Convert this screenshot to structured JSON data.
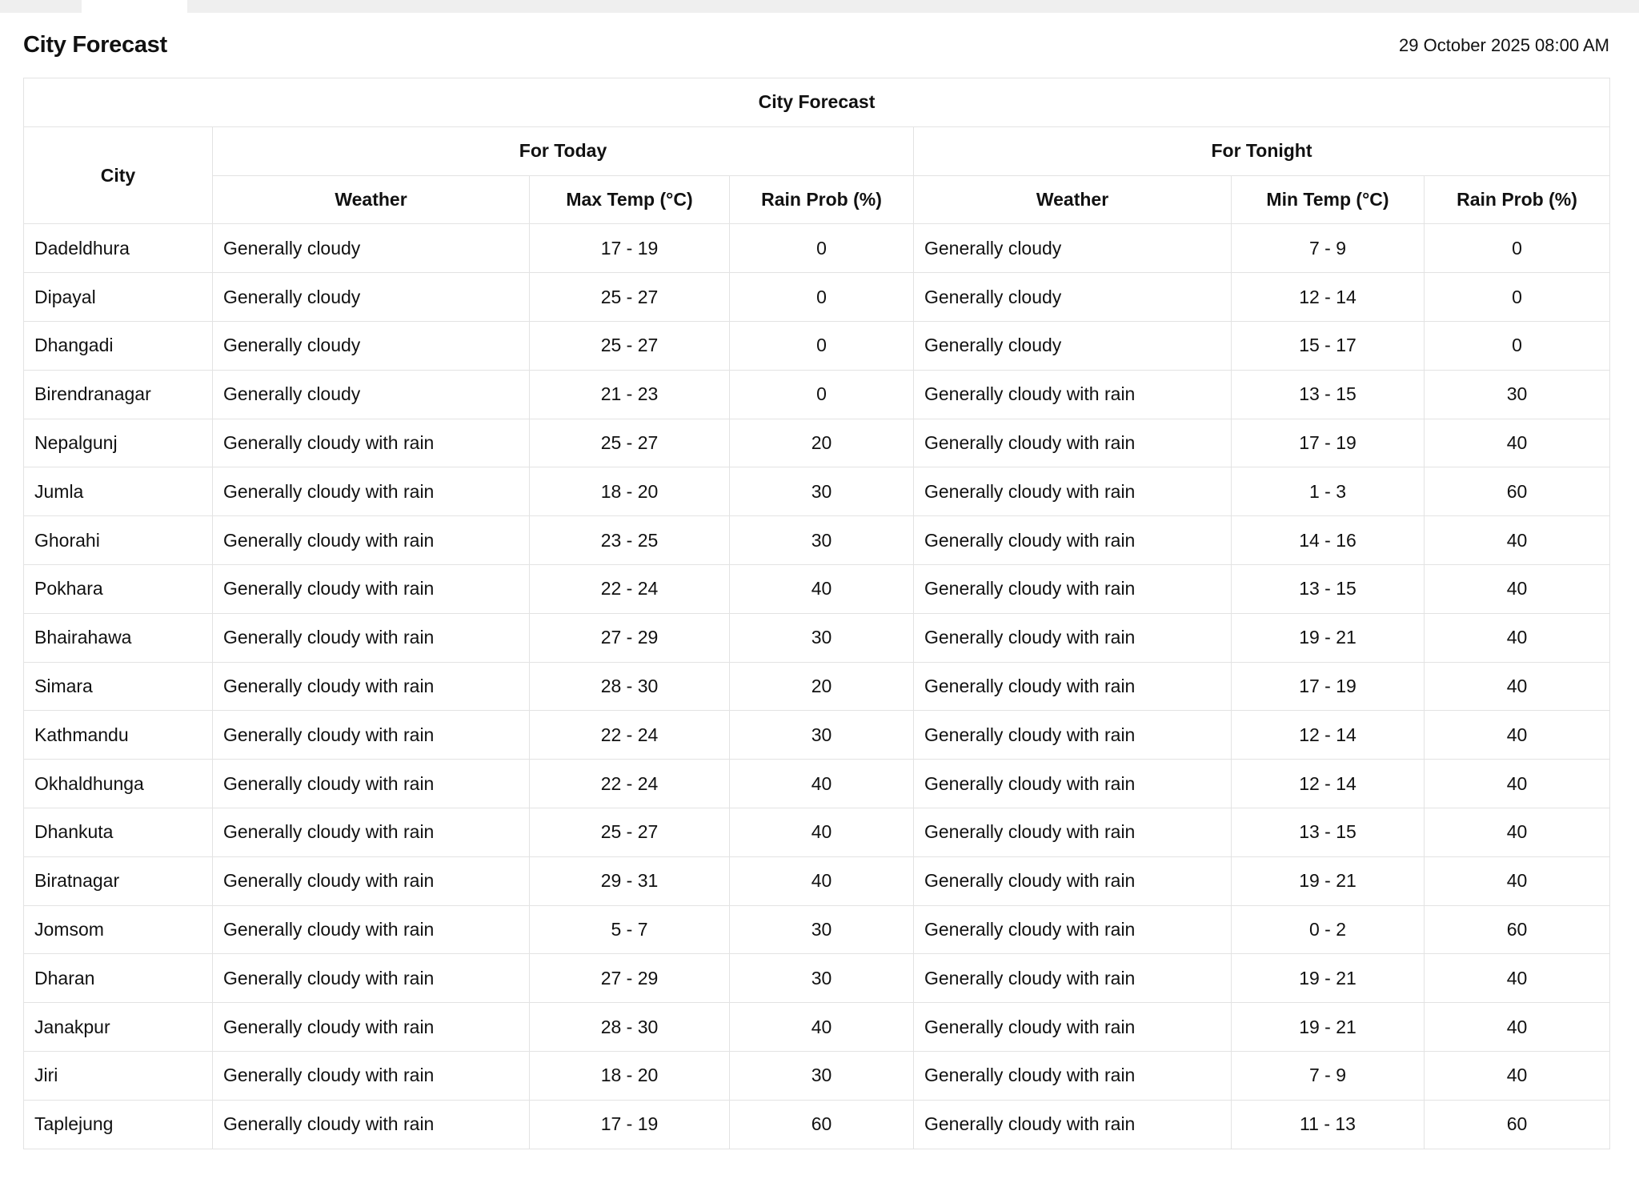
{
  "page": {
    "title": "City Forecast",
    "timestamp": "29 October 2025 08:00 AM"
  },
  "table": {
    "caption": "City Forecast",
    "city_header": "City",
    "today_header": "For Today",
    "tonight_header": "For Tonight",
    "today_columns": [
      "Weather",
      "Max Temp (°C)",
      "Rain Prob (%)"
    ],
    "tonight_columns": [
      "Weather",
      "Min Temp (°C)",
      "Rain Prob (%)"
    ],
    "rows": [
      {
        "city": "Dadeldhura",
        "today_weather": "Generally cloudy",
        "max_temp": "17 - 19",
        "today_rain": "0",
        "tonight_weather": "Generally cloudy",
        "min_temp": "7 - 9",
        "tonight_rain": "0"
      },
      {
        "city": "Dipayal",
        "today_weather": "Generally cloudy",
        "max_temp": "25 - 27",
        "today_rain": "0",
        "tonight_weather": "Generally cloudy",
        "min_temp": "12 - 14",
        "tonight_rain": "0"
      },
      {
        "city": "Dhangadi",
        "today_weather": "Generally cloudy",
        "max_temp": "25 - 27",
        "today_rain": "0",
        "tonight_weather": "Generally cloudy",
        "min_temp": "15 - 17",
        "tonight_rain": "0"
      },
      {
        "city": "Birendranagar",
        "today_weather": "Generally cloudy",
        "max_temp": "21 - 23",
        "today_rain": "0",
        "tonight_weather": "Generally cloudy with rain",
        "min_temp": "13 - 15",
        "tonight_rain": "30"
      },
      {
        "city": "Nepalgunj",
        "today_weather": "Generally cloudy with rain",
        "max_temp": "25 - 27",
        "today_rain": "20",
        "tonight_weather": "Generally cloudy with rain",
        "min_temp": "17 - 19",
        "tonight_rain": "40"
      },
      {
        "city": "Jumla",
        "today_weather": "Generally cloudy with rain",
        "max_temp": "18 - 20",
        "today_rain": "30",
        "tonight_weather": "Generally cloudy with rain",
        "min_temp": "1 - 3",
        "tonight_rain": "60"
      },
      {
        "city": "Ghorahi",
        "today_weather": "Generally cloudy with rain",
        "max_temp": "23 - 25",
        "today_rain": "30",
        "tonight_weather": "Generally cloudy with rain",
        "min_temp": "14 - 16",
        "tonight_rain": "40"
      },
      {
        "city": "Pokhara",
        "today_weather": "Generally cloudy with rain",
        "max_temp": "22 - 24",
        "today_rain": "40",
        "tonight_weather": "Generally cloudy with rain",
        "min_temp": "13 - 15",
        "tonight_rain": "40"
      },
      {
        "city": "Bhairahawa",
        "today_weather": "Generally cloudy with rain",
        "max_temp": "27 - 29",
        "today_rain": "30",
        "tonight_weather": "Generally cloudy with rain",
        "min_temp": "19 - 21",
        "tonight_rain": "40"
      },
      {
        "city": "Simara",
        "today_weather": "Generally cloudy with rain",
        "max_temp": "28 - 30",
        "today_rain": "20",
        "tonight_weather": "Generally cloudy with rain",
        "min_temp": "17 - 19",
        "tonight_rain": "40"
      },
      {
        "city": "Kathmandu",
        "today_weather": "Generally cloudy with rain",
        "max_temp": "22 - 24",
        "today_rain": "30",
        "tonight_weather": "Generally cloudy with rain",
        "min_temp": "12 - 14",
        "tonight_rain": "40"
      },
      {
        "city": "Okhaldhunga",
        "today_weather": "Generally cloudy with rain",
        "max_temp": "22 - 24",
        "today_rain": "40",
        "tonight_weather": "Generally cloudy with rain",
        "min_temp": "12 - 14",
        "tonight_rain": "40"
      },
      {
        "city": "Dhankuta",
        "today_weather": "Generally cloudy with rain",
        "max_temp": "25 - 27",
        "today_rain": "40",
        "tonight_weather": "Generally cloudy with rain",
        "min_temp": "13 - 15",
        "tonight_rain": "40"
      },
      {
        "city": "Biratnagar",
        "today_weather": "Generally cloudy with rain",
        "max_temp": "29 - 31",
        "today_rain": "40",
        "tonight_weather": "Generally cloudy with rain",
        "min_temp": "19 - 21",
        "tonight_rain": "40"
      },
      {
        "city": "Jomsom",
        "today_weather": "Generally cloudy with rain",
        "max_temp": "5 - 7",
        "today_rain": "30",
        "tonight_weather": "Generally cloudy with rain",
        "min_temp": "0 - 2",
        "tonight_rain": "60"
      },
      {
        "city": "Dharan",
        "today_weather": "Generally cloudy with rain",
        "max_temp": "27 - 29",
        "today_rain": "30",
        "tonight_weather": "Generally cloudy with rain",
        "min_temp": "19 - 21",
        "tonight_rain": "40"
      },
      {
        "city": "Janakpur",
        "today_weather": "Generally cloudy with rain",
        "max_temp": "28 - 30",
        "today_rain": "40",
        "tonight_weather": "Generally cloudy with rain",
        "min_temp": "19 - 21",
        "tonight_rain": "40"
      },
      {
        "city": "Jiri",
        "today_weather": "Generally cloudy with rain",
        "max_temp": "18 - 20",
        "today_rain": "30",
        "tonight_weather": "Generally cloudy with rain",
        "min_temp": "7 - 9",
        "tonight_rain": "40"
      },
      {
        "city": "Taplejung",
        "today_weather": "Generally cloudy with rain",
        "max_temp": "17 - 19",
        "today_rain": "60",
        "tonight_weather": "Generally cloudy with rain",
        "min_temp": "11 - 13",
        "tonight_rain": "60"
      }
    ]
  }
}
